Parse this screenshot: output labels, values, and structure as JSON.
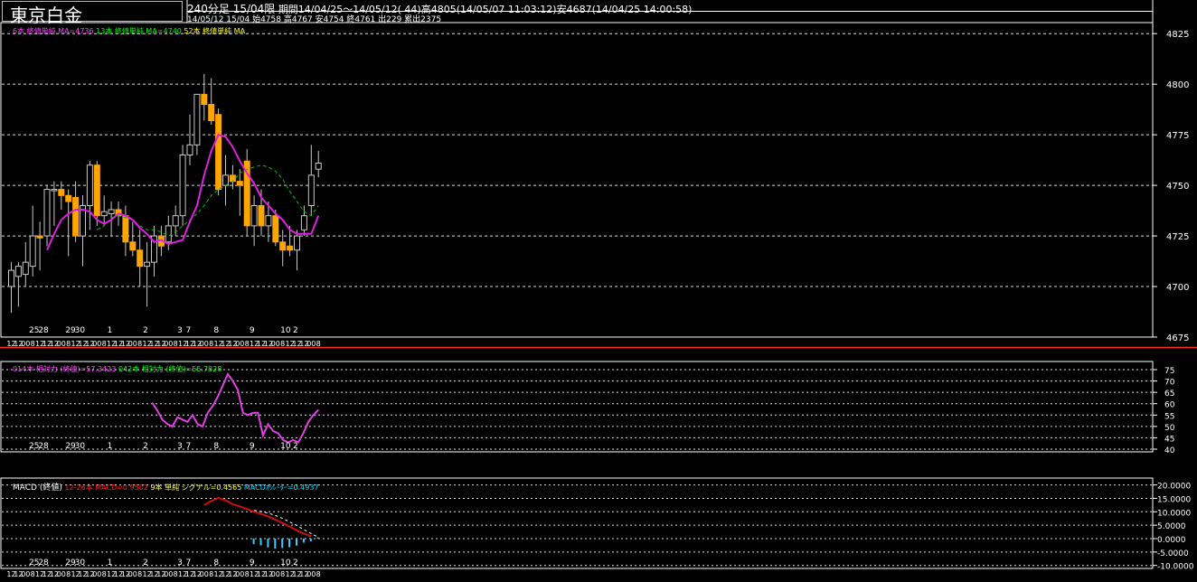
{
  "header": {
    "title": "東京白金",
    "timeframe": "240分足 15/04限",
    "period_info": "期間14/04/25～14/05/12( 44)高4805(14/05/07 11:03:12)安4687(14/04/25 14:00:58)",
    "last_bar_info": "14/05/12 15/04 始4758 高4767 安4754 終4761 出229 累出2375"
  },
  "legends": {
    "ma": [
      {
        "text": "6本 終値単純 MA=4736",
        "color": "#ff40ff"
      },
      {
        "text": "13本 終値単純 MA=4740",
        "color": "#00ff00"
      },
      {
        "text": "52本 終値単純 MA",
        "color": "#ffff00"
      }
    ],
    "rsi": [
      {
        "text": "014本 相対力 (終値)=57.3423",
        "color": "#ff40ff"
      },
      {
        "text": "042本 相対力 (終値)=55.7828",
        "color": "#00ff00"
      }
    ],
    "macd": [
      {
        "text": "MACD (終値)",
        "color": "#ffffff"
      },
      {
        "text": "12-26本 MACD=0.9502",
        "color": "#ff2020"
      },
      {
        "text": "9本 単純 シグナル=0.4565",
        "color": "#ffff40"
      },
      {
        "text": "MACDｵｼﾚｰﾀｰ=0.4937",
        "color": "#00e0ff"
      }
    ]
  },
  "colors": {
    "candle": "#ffa500",
    "wick": "#c8c8c8",
    "ma6": "#e020e0",
    "ma13": "#00c000",
    "rsi14": "#e040e0",
    "macd": "#cc1010",
    "signal": "#ffffff",
    "osc": "#40c8ff",
    "grid": "#dddddd",
    "frame": "#ffffff",
    "sep": "#ff3030"
  },
  "x_axis": {
    "day_labels": [
      {
        "bar": 3.2,
        "text": "25"
      },
      {
        "bar": 4.5,
        "text": "28"
      },
      {
        "bar": 8.3,
        "text": "29"
      },
      {
        "bar": 9.6,
        "text": "30"
      },
      {
        "bar": 13.8,
        "text": "1"
      },
      {
        "bar": 18.8,
        "text": "2"
      },
      {
        "bar": 23.6,
        "text": "3"
      },
      {
        "bar": 24.8,
        "text": "7"
      },
      {
        "bar": 28.7,
        "text": "8"
      },
      {
        "bar": 33.7,
        "text": "9"
      },
      {
        "bar": 38.4,
        "text": "10"
      },
      {
        "bar": 39.8,
        "text": "2"
      }
    ],
    "time_label_cycle": [
      "12",
      "12",
      "00",
      "8",
      "12"
    ]
  },
  "chart_data": [
    {
      "type": "candlestick",
      "ylim": [
        4675,
        4830
      ],
      "yticks": [
        4675,
        4700,
        4725,
        4750,
        4775,
        4800,
        4825
      ],
      "bars": [
        {
          "o": 4700,
          "h": 4712,
          "l": 4687,
          "c": 4708
        },
        {
          "o": 4705,
          "h": 4712,
          "l": 4690,
          "c": 4710
        },
        {
          "o": 4706,
          "h": 4722,
          "l": 4700,
          "c": 4712
        },
        {
          "o": 4710,
          "h": 4740,
          "l": 4705,
          "c": 4725
        },
        {
          "o": 4725,
          "h": 4732,
          "l": 4708,
          "c": 4724
        },
        {
          "o": 4725,
          "h": 4750,
          "l": 4720,
          "c": 4748
        },
        {
          "o": 4748,
          "h": 4752,
          "l": 4730,
          "c": 4748
        },
        {
          "o": 4748,
          "h": 4752,
          "l": 4738,
          "c": 4745
        },
        {
          "o": 4745,
          "h": 4748,
          "l": 4715,
          "c": 4742
        },
        {
          "o": 4744,
          "h": 4752,
          "l": 4722,
          "c": 4725
        },
        {
          "o": 4725,
          "h": 4745,
          "l": 4710,
          "c": 4740
        },
        {
          "o": 4740,
          "h": 4762,
          "l": 4728,
          "c": 4760
        },
        {
          "o": 4760,
          "h": 4762,
          "l": 4730,
          "c": 4735
        },
        {
          "o": 4735,
          "h": 4745,
          "l": 4730,
          "c": 4737
        },
        {
          "o": 4736,
          "h": 4742,
          "l": 4725,
          "c": 4738
        },
        {
          "o": 4738,
          "h": 4742,
          "l": 4730,
          "c": 4735
        },
        {
          "o": 4735,
          "h": 4740,
          "l": 4715,
          "c": 4722
        },
        {
          "o": 4722,
          "h": 4732,
          "l": 4715,
          "c": 4718
        },
        {
          "o": 4718,
          "h": 4728,
          "l": 4700,
          "c": 4710
        },
        {
          "o": 4710,
          "h": 4722,
          "l": 4690,
          "c": 4712
        },
        {
          "o": 4712,
          "h": 4730,
          "l": 4705,
          "c": 4725
        },
        {
          "o": 4725,
          "h": 4730,
          "l": 4715,
          "c": 4720
        },
        {
          "o": 4722,
          "h": 4735,
          "l": 4718,
          "c": 4730
        },
        {
          "o": 4730,
          "h": 4740,
          "l": 4725,
          "c": 4735
        },
        {
          "o": 4735,
          "h": 4770,
          "l": 4730,
          "c": 4765
        },
        {
          "o": 4765,
          "h": 4785,
          "l": 4760,
          "c": 4770
        },
        {
          "o": 4770,
          "h": 4795,
          "l": 4765,
          "c": 4795
        },
        {
          "o": 4795,
          "h": 4805,
          "l": 4782,
          "c": 4790
        },
        {
          "o": 4790,
          "h": 4803,
          "l": 4780,
          "c": 4782
        },
        {
          "o": 4785,
          "h": 4788,
          "l": 4745,
          "c": 4748
        },
        {
          "o": 4750,
          "h": 4765,
          "l": 4740,
          "c": 4755
        },
        {
          "o": 4755,
          "h": 4760,
          "l": 4748,
          "c": 4752
        },
        {
          "o": 4752,
          "h": 4758,
          "l": 4735,
          "c": 4750
        },
        {
          "o": 4762,
          "h": 4768,
          "l": 4725,
          "c": 4730
        },
        {
          "o": 4730,
          "h": 4745,
          "l": 4720,
          "c": 4740
        },
        {
          "o": 4740,
          "h": 4748,
          "l": 4725,
          "c": 4730
        },
        {
          "o": 4730,
          "h": 4742,
          "l": 4722,
          "c": 4735
        },
        {
          "o": 4735,
          "h": 4738,
          "l": 4720,
          "c": 4722
        },
        {
          "o": 4722,
          "h": 4728,
          "l": 4710,
          "c": 4718
        },
        {
          "o": 4720,
          "h": 4730,
          "l": 4715,
          "c": 4718
        },
        {
          "o": 4718,
          "h": 4728,
          "l": 4708,
          "c": 4725
        },
        {
          "o": 4728,
          "h": 4740,
          "l": 4725,
          "c": 4735
        },
        {
          "o": 4740,
          "h": 4770,
          "l": 4735,
          "c": 4755
        },
        {
          "o": 4758,
          "h": 4767,
          "l": 4754,
          "c": 4761
        }
      ],
      "ma6": [
        null,
        null,
        null,
        null,
        null,
        4718,
        4726,
        4733,
        4736,
        4738,
        4738,
        4737,
        4733,
        4731,
        4733,
        4736,
        4735,
        4733,
        4729,
        4726,
        4722,
        4723,
        4721,
        4722,
        4723,
        4732,
        4740,
        4755,
        4767,
        4775,
        4774,
        4769,
        4762,
        4756,
        4751,
        4744,
        4740,
        4736,
        4733,
        4728,
        4726,
        4726,
        4726,
        4735
      ],
      "ma13": [
        null,
        null,
        null,
        null,
        null,
        null,
        null,
        null,
        null,
        null,
        null,
        null,
        4728,
        4730,
        4734,
        4735,
        4734,
        4733,
        4730,
        4728,
        4728,
        4727,
        4725,
        4727,
        4730,
        4733,
        4736,
        4740,
        4745,
        4748,
        4750,
        4752,
        4756,
        4758,
        4759,
        4760,
        4759,
        4757,
        4753,
        4747,
        4742,
        4737,
        4735,
        4740
      ]
    },
    {
      "type": "line",
      "ylim": [
        40,
        75
      ],
      "yticks": [
        40,
        45,
        50,
        55,
        60,
        65,
        70,
        75
      ],
      "rsi14": [
        null,
        null,
        null,
        null,
        null,
        null,
        null,
        null,
        null,
        null,
        null,
        null,
        null,
        null,
        null,
        null,
        null,
        null,
        null,
        null,
        null,
        null,
        null,
        null,
        null,
        null,
        null,
        null,
        60.5,
        57,
        53,
        51,
        50,
        54,
        53,
        52,
        55,
        51,
        50,
        56,
        59,
        63,
        68,
        73,
        70,
        66,
        56,
        55,
        56,
        56,
        46,
        51,
        48,
        47,
        44,
        43,
        44,
        43,
        47,
        52,
        55,
        57.3
      ]
    },
    {
      "type": "line+bar",
      "ylim": [
        -10,
        20
      ],
      "yticks": [
        20,
        15,
        10,
        5,
        0,
        -5,
        -10
      ],
      "ytick_labels": [
        "20.0000",
        "15.0000",
        "10.0000",
        "5.0000",
        "0.0000",
        "-5.0000",
        "-10.0000"
      ],
      "macd": [
        null,
        null,
        null,
        null,
        null,
        null,
        null,
        null,
        null,
        null,
        null,
        null,
        null,
        null,
        null,
        null,
        null,
        null,
        null,
        null,
        null,
        null,
        null,
        null,
        null,
        null,
        null,
        12.5,
        14,
        15.2,
        14.3,
        12.8,
        12,
        11,
        10,
        9.2,
        8.2,
        7,
        5.8,
        4.5,
        3,
        1.8,
        0.9502
      ],
      "signal": [
        null,
        null,
        null,
        null,
        null,
        null,
        null,
        null,
        null,
        null,
        null,
        null,
        null,
        null,
        null,
        null,
        null,
        null,
        null,
        null,
        null,
        null,
        null,
        null,
        null,
        null,
        null,
        null,
        null,
        null,
        null,
        null,
        null,
        null,
        10.5,
        10.1,
        9.5,
        8.6,
        7.5,
        6.2,
        4.8,
        3.3,
        1.9,
        0.4565
      ],
      "osc": [
        null,
        null,
        null,
        null,
        null,
        null,
        null,
        null,
        null,
        null,
        null,
        null,
        null,
        null,
        null,
        null,
        null,
        null,
        null,
        null,
        null,
        null,
        null,
        null,
        null,
        null,
        null,
        null,
        null,
        null,
        null,
        null,
        null,
        null,
        -2,
        -2.5,
        -3.3,
        -3.7,
        -3.5,
        -3.2,
        -2.6,
        -1.5,
        -1,
        0.4937
      ]
    }
  ]
}
